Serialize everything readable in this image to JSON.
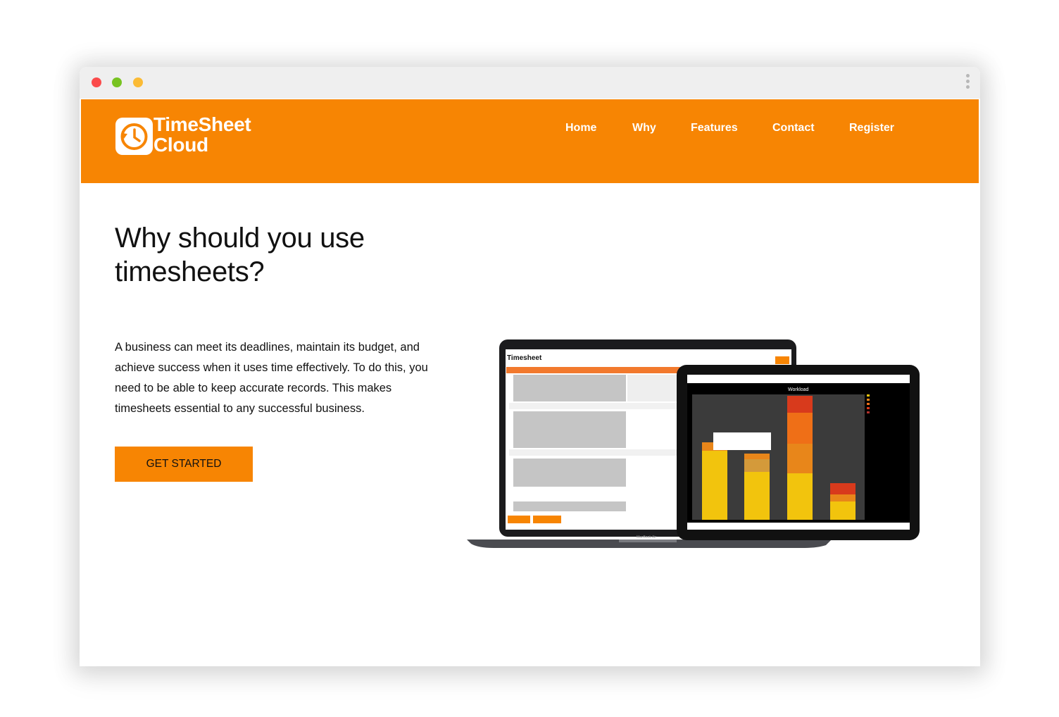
{
  "brand": {
    "name": "TimeSheet\nCloud",
    "orange": "#f78503",
    "logo_icon": "clock-history-icon"
  },
  "nav": {
    "items": [
      "Home",
      "Why",
      "Features",
      "Contact",
      "Register"
    ]
  },
  "hero": {
    "title": "Why should you use timesheets?",
    "body": "A business can meet its deadlines, maintain its budget, and achieve success when it uses time effectively. To do this, you need to be able to keep accurate records. This makes timesheets essential to any successful business.",
    "cta": "GET STARTED"
  },
  "mockup": {
    "laptop_title": "Timesheet",
    "laptop_brand": "MacBook Air",
    "tablet_title": "Workload"
  }
}
